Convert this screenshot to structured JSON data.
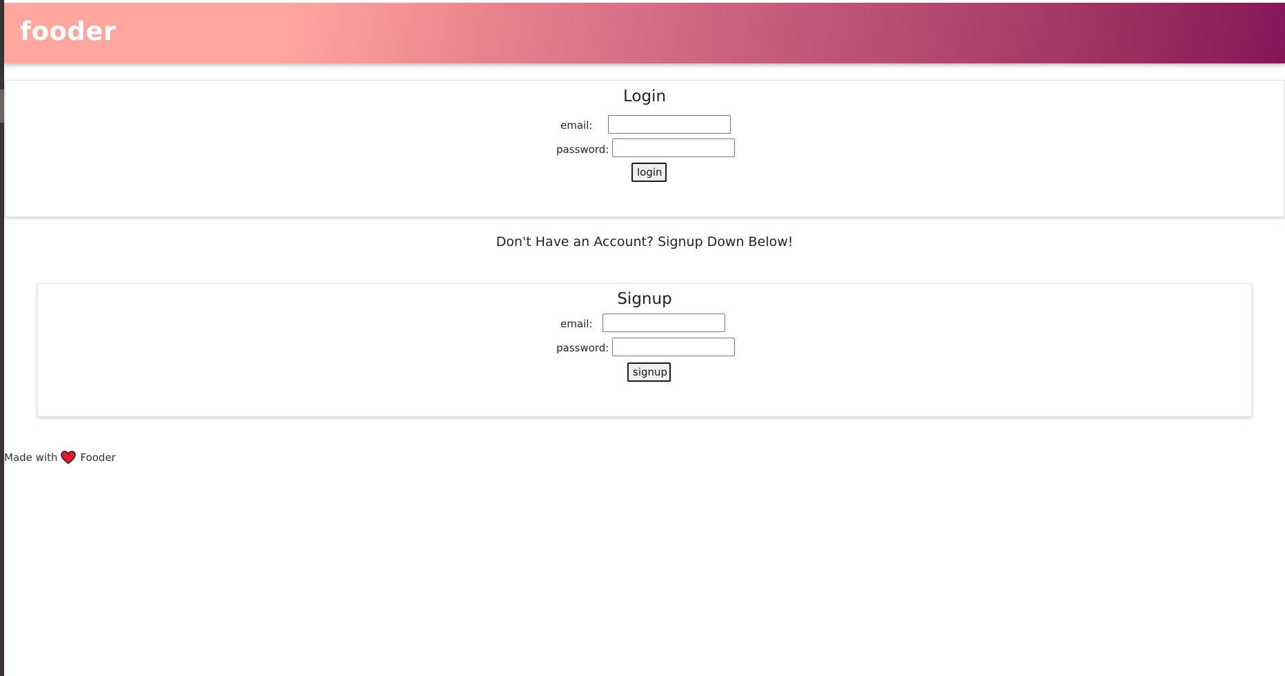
{
  "header": {
    "brand": "fooder"
  },
  "login": {
    "title": "Login",
    "email_label": "email:",
    "password_label": "password:",
    "email_value": "",
    "password_value": "",
    "button_label": "login"
  },
  "signup_prompt": "Don't Have an Account? Signup Down Below!",
  "signup": {
    "title": "Signup",
    "email_label": "email:",
    "password_label": "password:",
    "email_value": "",
    "password_value": "",
    "button_label": "signup"
  },
  "footer": {
    "made_with": "Made with",
    "heart_icon": "heart-icon",
    "brand": "Fooder",
    "heart_color": "#e8192c"
  },
  "colors": {
    "header_gradient_start": "#ffa69e",
    "header_gradient_end": "#861657"
  }
}
